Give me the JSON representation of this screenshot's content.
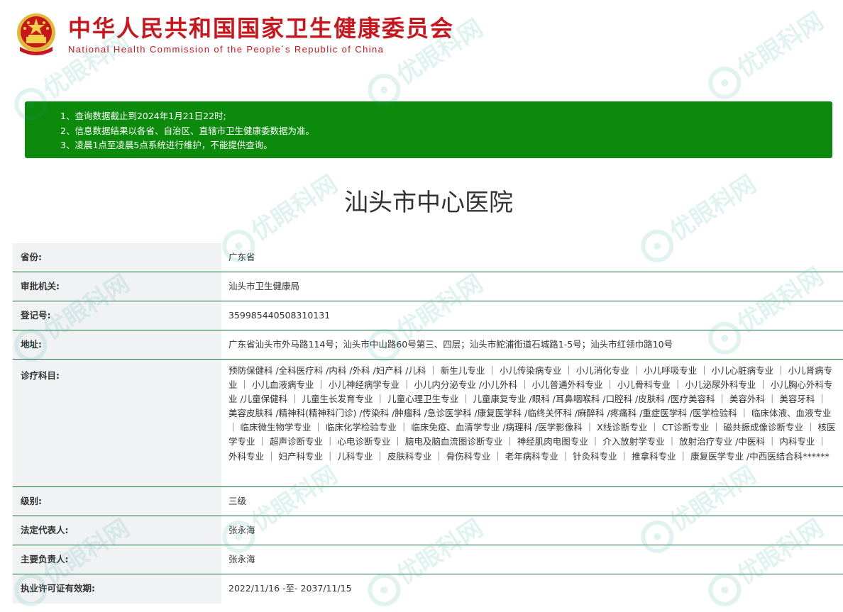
{
  "header": {
    "title_cn": "中华人民共和国国家卫生健康委员会",
    "title_en": "National Health Commission of the People´s Republic of China",
    "emblem_icon": "national-emblem-icon"
  },
  "notice": {
    "lines": [
      "1、查询数据截止到2024年1月21日22时;",
      "2、信息数据结果以各省、自治区、直辖市卫生健康委数据为准。",
      "3、凌晨1点至凌晨5点系统进行维护，不能提供查询。"
    ]
  },
  "hospital_name": "汕头市中心医院",
  "info": {
    "province_label": "省份:",
    "province": "广东省",
    "authority_label": "审批机关:",
    "authority": "汕头市卫生健康局",
    "reg_no_label": "登记号:",
    "reg_no": "359985440508310131",
    "address_label": "地址:",
    "address": "广东省汕头市外马路114号；汕头市中山路60号第三、四层；汕头市鮀浦街道石城路1-5号；汕头市红领巾路10号",
    "departments_label": "诊疗科目:",
    "departments": "预防保健科 /全科医疗科 /内科 /外科 /妇产科 /儿科 ｜ 新生儿专业 ｜ 小儿传染病专业 ｜ 小儿消化专业 ｜ 小儿呼吸专业 ｜ 小儿心脏病专业 ｜ 小儿肾病专业 ｜ 小儿血液病专业 ｜ 小儿神经病学专业 ｜ 小儿内分泌专业 /小儿外科 ｜ 小儿普通外科专业 ｜ 小儿骨科专业 ｜ 小儿泌尿外科专业 ｜ 小儿胸心外科专业 /儿童保健科 ｜ 儿童生长发育专业 ｜ 儿童心理卫生专业 ｜ 儿童康复专业 /眼科 /耳鼻咽喉科 /口腔科 /皮肤科 /医疗美容科 ｜ 美容外科 ｜ 美容牙科 ｜ 美容皮肤科 /精神科(精神科门诊) /传染科 /肿瘤科 /急诊医学科 /康复医学科 /临终关怀科 /麻醉科 /疼痛科 /重症医学科 /医学检验科 ｜ 临床体液、血液专业 ｜ 临床微生物学专业 ｜ 临床化学检验专业 ｜ 临床免疫、血清学专业 /病理科 /医学影像科 ｜ X线诊断专业 ｜ CT诊断专业 ｜ 磁共振成像诊断专业 ｜ 核医学专业 ｜ 超声诊断专业 ｜ 心电诊断专业 ｜ 脑电及脑血流图诊断专业 ｜ 神经肌肉电图专业 ｜ 介入放射学专业 ｜ 放射治疗专业 /中医科 ｜ 内科专业 ｜ 外科专业 ｜ 妇产科专业 ｜ 儿科专业 ｜ 皮肤科专业 ｜ 骨伤科专业 ｜ 老年病科专业 ｜ 针灸科专业 ｜ 推拿科专业 ｜ 康复医学专业 /中西医结合科******",
    "level_label": "级别:",
    "level": "三级",
    "legal_rep_label": "法定代表人:",
    "legal_rep": "张永海",
    "principal_label": "主要负责人:",
    "principal": "张永海",
    "license_label": "执业许可证有效期:",
    "license_validity": "2022/11/16 -至- 2037/11/15"
  },
  "watermark": {
    "text": "优眼科网",
    "icon": "eye-logo-icon"
  },
  "colors": {
    "header_red": "#c8161d",
    "notice_green": "#0b8a0b",
    "row_border": "#1b6b3a",
    "label_bg": "#f1f2f3",
    "watermark_teal": "#23a59b"
  }
}
